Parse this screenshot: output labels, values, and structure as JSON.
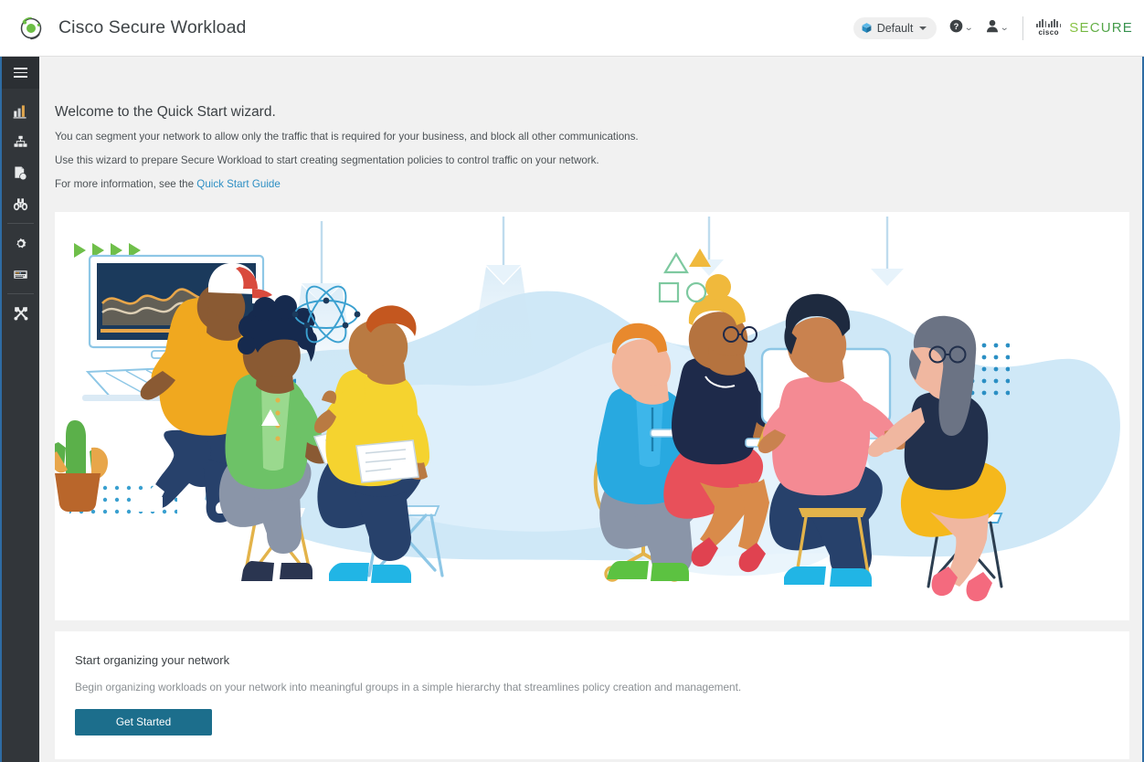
{
  "header": {
    "app_title": "Cisco Secure Workload",
    "logo_icon": "cisco-secure-workload-orbit-logo",
    "scope_selector": {
      "label": "Default",
      "icon": "cube-icon",
      "caret_icon": "chevron-down-icon"
    },
    "help": {
      "icon": "help-circle-icon",
      "caret_icon": "chevron-down-icon"
    },
    "user": {
      "icon": "user-icon",
      "caret_icon": "chevron-down-icon"
    },
    "branding": {
      "cisco_word": "cisco",
      "secure_word": "SECURE"
    }
  },
  "sidebar": {
    "toggle": {
      "icon": "hamburger-menu-icon",
      "label": "Menu"
    },
    "items": [
      {
        "icon": "bar-chart-icon",
        "label": "Overview"
      },
      {
        "icon": "org-hierarchy-icon",
        "label": "Organize"
      },
      {
        "icon": "policy-shield-icon",
        "label": "Defend"
      },
      {
        "icon": "binoculars-icon",
        "label": "Investigate"
      },
      {
        "icon": "gear-icon",
        "label": "Manage"
      },
      {
        "icon": "console-panel-icon",
        "label": "Monitor"
      },
      {
        "icon": "tools-icon",
        "label": "Tools"
      }
    ],
    "divider_after_index": [
      3,
      5
    ]
  },
  "main": {
    "welcome_heading": "Welcome to the Quick Start wizard.",
    "paragraph_1": "You can segment your network to allow only the traffic that is required for your business, and block all other communications.",
    "paragraph_2": "Use this wizard to prepare Secure Workload to start creating segmentation policies to control traffic on your network.",
    "paragraph_3_prefix": "For more information, see the ",
    "quick_start_link": "Quick Start Guide",
    "hero": {
      "alt": "illustration-people-collaborating-at-workstations"
    },
    "start_card": {
      "title": "Start organizing your network",
      "description": "Begin organizing workloads on your network into meaningful groups in a simple hierarchy that streamlines policy creation and management.",
      "button_label": "Get Started"
    }
  },
  "colors": {
    "accent_blue": "#2e6ca3",
    "button_teal": "#1c6e8c",
    "link_blue": "#2e8fc4",
    "rail_bg": "#32363a",
    "page_bg": "#f1f1f1",
    "logo_green": "#6cbe45",
    "secure_green": "#5ba845"
  }
}
